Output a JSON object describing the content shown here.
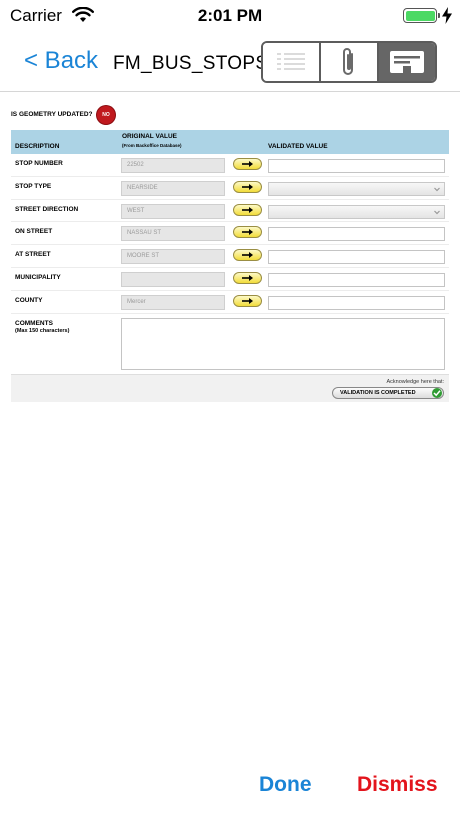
{
  "status_bar": {
    "carrier": "Carrier",
    "time": "2:01 PM"
  },
  "nav": {
    "back_label": "< Back",
    "title": "FM_BUS_STOPS",
    "segments": [
      {
        "icon": "list-icon"
      },
      {
        "icon": "paperclip-icon"
      },
      {
        "icon": "form-icon",
        "active": true
      }
    ]
  },
  "form": {
    "geometry_label": "IS GEOMETRY UPDATED?",
    "geometry_value": "NO",
    "header": {
      "description": "DESCRIPTION",
      "original_value": "ORIGINAL VALUE",
      "original_value_sub": "(From Backoffice Database)",
      "validated_value": "VALIDATED VALUE"
    },
    "rows": [
      {
        "label": "STOP NUMBER",
        "original": "22502",
        "input_type": "text"
      },
      {
        "label": "STOP TYPE",
        "original": "NEARSIDE",
        "input_type": "select"
      },
      {
        "label": "STREET DIRECTION",
        "original": "WEST",
        "input_type": "select"
      },
      {
        "label": "ON STREET",
        "original": "NASSAU ST",
        "input_type": "text"
      },
      {
        "label": "AT STREET",
        "original": "MOORE ST",
        "input_type": "text"
      },
      {
        "label": "MUNICIPALITY",
        "original": "",
        "input_type": "text"
      },
      {
        "label": "COUNTY",
        "original": "Mercer",
        "input_type": "text"
      }
    ],
    "comments_label": "COMMENTS",
    "comments_sub": "(Max 150 characters)",
    "ack_label": "Acknowledge here that:",
    "ack_button": "VALIDATION IS COMPLETED"
  },
  "toolbar": {
    "done_label": "Done",
    "dismiss_label": "Dismiss"
  },
  "colors": {
    "accent_blue": "#1a84d6",
    "dismiss_red": "#e3141c",
    "header_blue": "#acd3e5",
    "no_badge_red": "#c0191e",
    "copy_yellow": "#f2dc39"
  }
}
